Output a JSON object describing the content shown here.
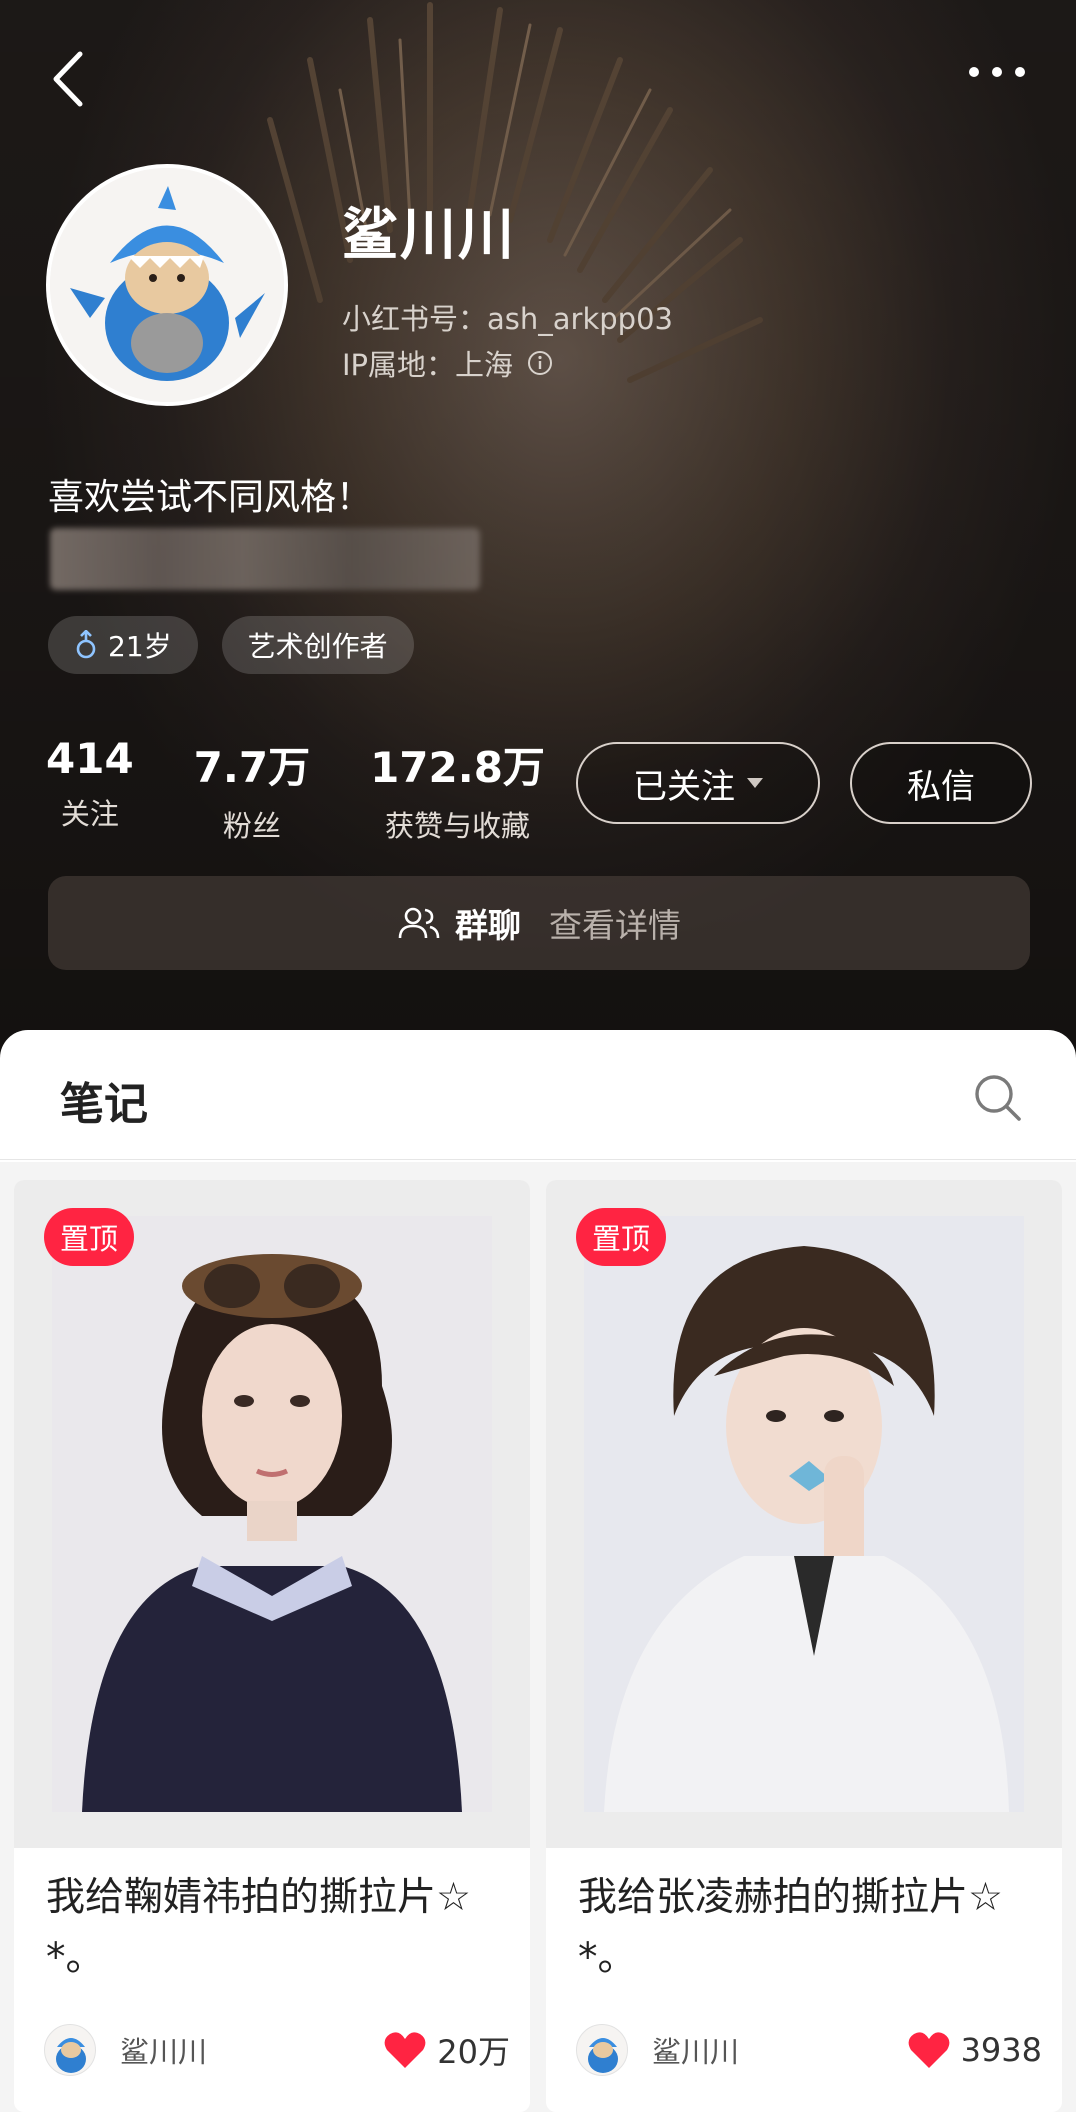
{
  "profile": {
    "nickname": "鲨川川",
    "red_id": "小红书号：ash_arkpp03",
    "ip_location": "IP属地：上海",
    "bio": "喜欢尝试不同风格！",
    "tags": [
      {
        "icon": "male-icon",
        "label": "21岁"
      },
      {
        "label": "艺术创作者"
      }
    ]
  },
  "stats": [
    {
      "value": "414",
      "label": "关注"
    },
    {
      "value": "7.7万",
      "label": "粉丝"
    },
    {
      "value": "172.8万",
      "label": "获赞与收藏"
    }
  ],
  "actions": {
    "follow_label": "已关注",
    "message_label": "私信"
  },
  "group_chat": {
    "label": "群聊",
    "detail": "查看详情"
  },
  "notes": {
    "tab_title": "笔记",
    "items": [
      {
        "pinned": "置顶",
        "title": "我给鞠婧祎拍的撕拉片☆ *。",
        "author": "鲨川川",
        "likes": "20万"
      },
      {
        "pinned": "置顶",
        "title": "我给张凌赫拍的撕拉片☆ *。",
        "author": "鲨川川",
        "likes": "3938"
      }
    ]
  },
  "colors": {
    "accent": "#ff2442",
    "header_bg": "#2a2320"
  }
}
